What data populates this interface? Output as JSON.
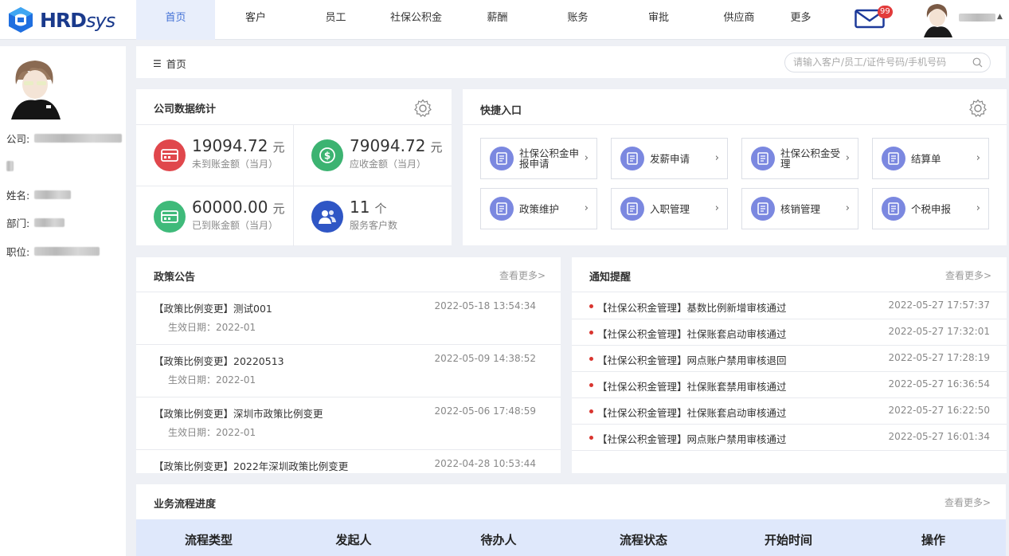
{
  "brand": {
    "logo_main": "HRD",
    "logo_sys": "sys"
  },
  "nav": {
    "items": [
      {
        "label": "首页",
        "active": true,
        "width": 99
      },
      {
        "label": "客户",
        "active": false,
        "width": 102
      },
      {
        "label": "员工",
        "active": false,
        "width": 99
      },
      {
        "label": "社保公积金",
        "active": false,
        "width": 103
      },
      {
        "label": "薪酬",
        "active": false,
        "width": 101
      },
      {
        "label": "账务",
        "active": false,
        "width": 101
      },
      {
        "label": "审批",
        "active": false,
        "width": 102
      },
      {
        "label": "供应商",
        "active": false,
        "width": 100
      },
      {
        "label": "更多",
        "active": false,
        "width": 55
      }
    ],
    "mail_badge": "99"
  },
  "profile": {
    "company_label": "公司:",
    "name_label": "姓名:",
    "dept_label": "部门:",
    "position_label": "职位:"
  },
  "breadcrumb": {
    "home": "首页"
  },
  "search": {
    "placeholder": "请输入客户/员工/证件号码/手机号码"
  },
  "stats": {
    "title": "公司数据统计",
    "items": [
      {
        "value": "19094.72",
        "unit": "元",
        "label": "未到账金额（当月）",
        "color": "#e0474c",
        "icon": "card-icon"
      },
      {
        "value": "79094.72",
        "unit": "元",
        "label": "应收金额（当月）",
        "color": "#3cb371",
        "icon": "money-icon"
      },
      {
        "value": "60000.00",
        "unit": "元",
        "label": "已到账金额（当月）",
        "color": "#3fba7a",
        "icon": "card-icon"
      },
      {
        "value": "11",
        "unit": "个",
        "label": "服务客户数",
        "color": "#2f56c5",
        "icon": "users-icon"
      }
    ]
  },
  "quick": {
    "title": "快捷入口",
    "items": [
      {
        "label": "社保公积金申报申请",
        "name": "social-insurance-apply"
      },
      {
        "label": "发薪申请",
        "name": "payroll-apply"
      },
      {
        "label": "社保公积金受理",
        "name": "social-insurance-accept"
      },
      {
        "label": "结算单",
        "name": "settlement"
      },
      {
        "label": "政策维护",
        "name": "policy-maintain"
      },
      {
        "label": "入职管理",
        "name": "onboarding"
      },
      {
        "label": "核销管理",
        "name": "write-off"
      },
      {
        "label": "个税申报",
        "name": "tax-declare"
      }
    ]
  },
  "policy": {
    "title": "政策公告",
    "more": "查看更多>",
    "items": [
      {
        "title": "【政策比例变更】测试001",
        "date": "生效日期：2022-01",
        "time": "2022-05-18 13:54:34"
      },
      {
        "title": "【政策比例变更】20220513",
        "date": "生效日期：2022-01",
        "time": "2022-05-09 14:38:52"
      },
      {
        "title": "【政策比例变更】深圳市政策比例变更",
        "date": "生效日期：2022-01",
        "time": "2022-05-06 17:48:59"
      },
      {
        "title": "【政策比例变更】2022年深圳政策比例变更",
        "date": "",
        "time": "2022-04-28 10:53:44"
      }
    ]
  },
  "notice": {
    "title": "通知提醒",
    "more": "查看更多>",
    "items": [
      {
        "text": "【社保公积金管理】基数比例新增审核通过",
        "time": "2022-05-27 17:57:37"
      },
      {
        "text": "【社保公积金管理】社保账套启动审核通过",
        "time": "2022-05-27 17:32:01"
      },
      {
        "text": "【社保公积金管理】网点账户禁用审核退回",
        "time": "2022-05-27 17:28:19"
      },
      {
        "text": "【社保公积金管理】社保账套禁用审核通过",
        "time": "2022-05-27 16:36:54"
      },
      {
        "text": "【社保公积金管理】社保账套启动审核通过",
        "time": "2022-05-27 16:22:50"
      },
      {
        "text": "【社保公积金管理】网点账户禁用审核通过",
        "time": "2022-05-27 16:01:34"
      }
    ]
  },
  "workflow": {
    "title": "业务流程进度",
    "more": "查看更多>",
    "columns": [
      "流程类型",
      "发起人",
      "待办人",
      "流程状态",
      "开始时间",
      "操作"
    ]
  }
}
